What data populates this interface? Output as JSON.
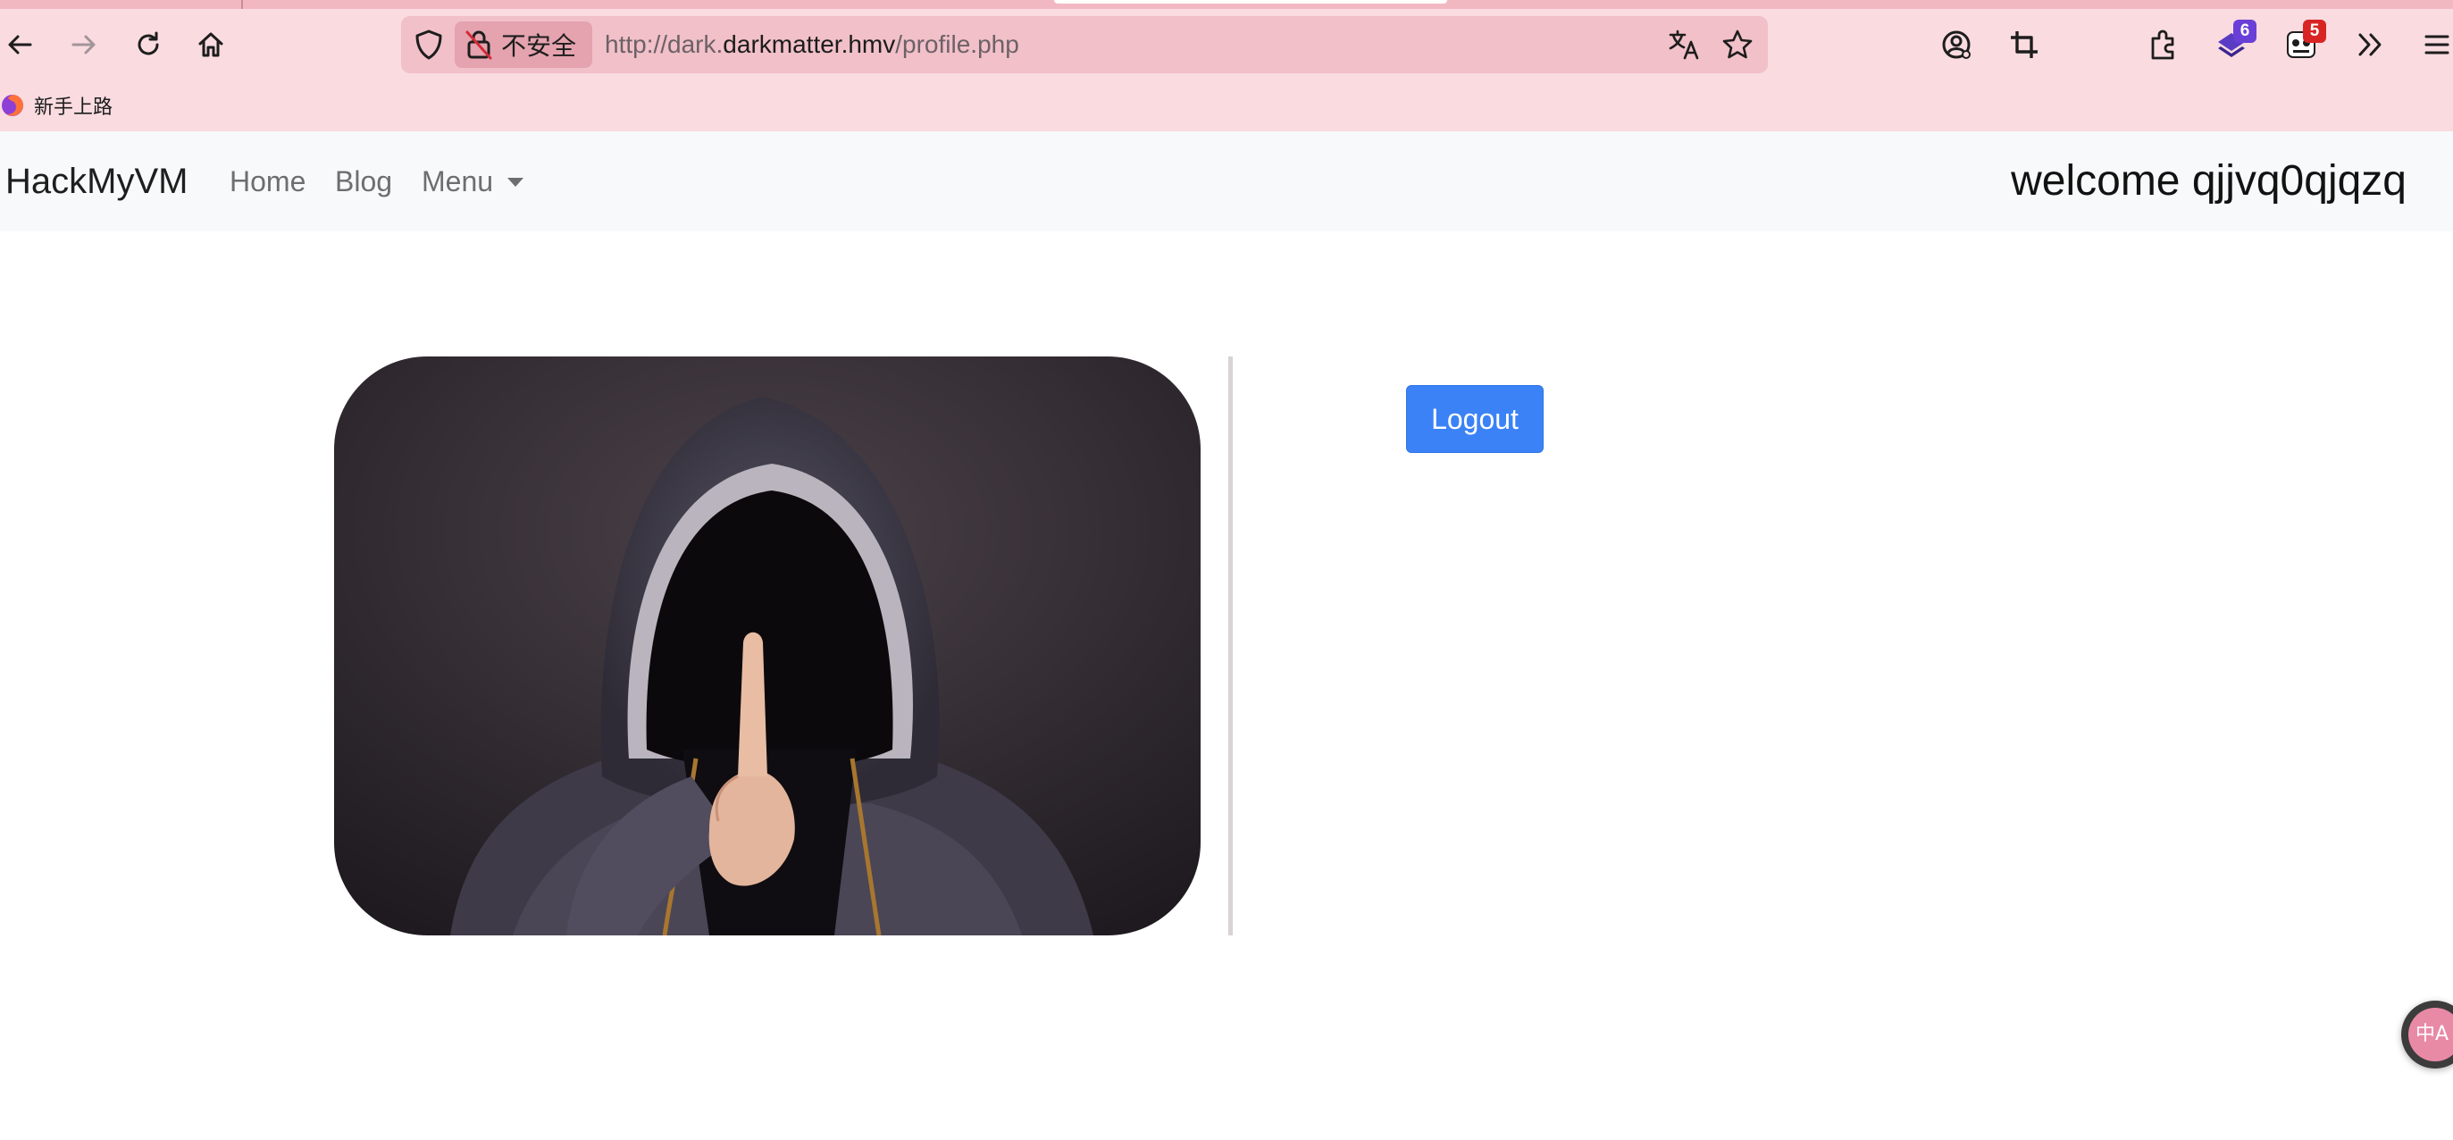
{
  "browser": {
    "security_label": "不安全",
    "url_scheme": "http://dark.",
    "url_host": "darkmatter.hmv",
    "url_path": "/profile.php",
    "bookmark_label": "新手上路",
    "extension_badges": [
      "6",
      "5"
    ],
    "icons": [
      "back-icon",
      "forward-icon",
      "reload-icon",
      "home-icon",
      "shield-icon",
      "insecure-lock-icon",
      "translate-icon",
      "bookmark-star-icon",
      "account-icon",
      "screenshot-crop-icon",
      "extensions-icon",
      "extension-layers-icon",
      "extension-panda-icon",
      "overflow-chevron-icon",
      "menu-icon",
      "firefox-icon"
    ],
    "colors": {
      "chrome": "#f9dbe0",
      "urlbar": "#f1c0c8",
      "badge_purple": "#6a3fd8",
      "badge_red": "#d92424"
    }
  },
  "navbar": {
    "brand": "HackMyVM",
    "links": [
      "Home",
      "Blog",
      "Menu"
    ],
    "welcome": "welcome qjjvq0qjqzq"
  },
  "main": {
    "logout_label": "Logout",
    "accent_color": "#3b82f6"
  },
  "floating": {
    "translate_label": "中A"
  }
}
